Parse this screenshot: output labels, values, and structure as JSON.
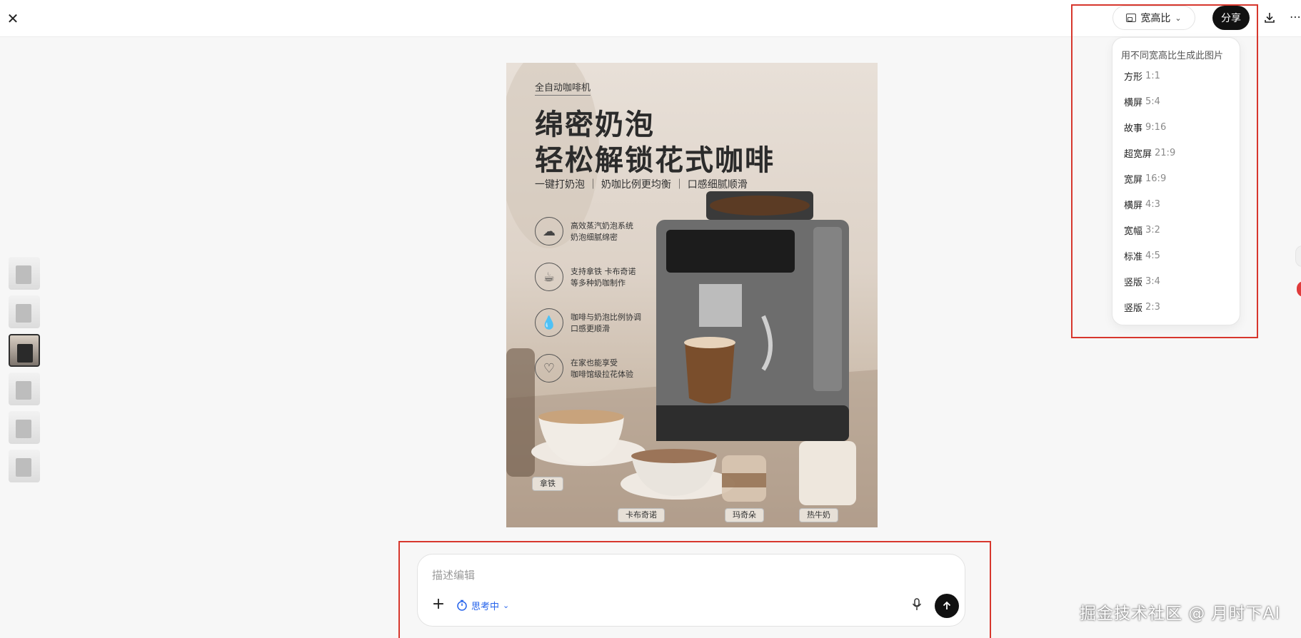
{
  "topbar": {
    "close_icon": "close-icon",
    "aspect_button_label": "宽高比",
    "share_label": "分享",
    "download_icon": "download-icon",
    "more_icon": "more-icon"
  },
  "aspect_menu": {
    "title": "用不同宽高比生成此图片",
    "options": [
      {
        "name": "方形",
        "ratio": "1:1"
      },
      {
        "name": "横屏",
        "ratio": "5:4"
      },
      {
        "name": "故事",
        "ratio": "9:16"
      },
      {
        "name": "超宽屏",
        "ratio": "21:9"
      },
      {
        "name": "宽屏",
        "ratio": "16:9"
      },
      {
        "name": "横屏",
        "ratio": "4:3"
      },
      {
        "name": "宽幅",
        "ratio": "3:2"
      },
      {
        "name": "标准",
        "ratio": "4:5"
      },
      {
        "name": "竖版",
        "ratio": "3:4"
      },
      {
        "name": "竖版",
        "ratio": "2:3"
      }
    ]
  },
  "thumbnails": {
    "count": 6,
    "active_index": 2
  },
  "poster": {
    "tag": "全自动咖啡机",
    "headline1": "绵密奶泡",
    "headline2": "轻松解锁花式咖啡",
    "subline": "一键打奶泡 ｜ 奶咖比例更均衡 ｜ 口感细腻顺滑",
    "features": [
      {
        "icon": "steam-cloud-icon",
        "line1": "高效蒸汽奶泡系统",
        "line2": "奶泡细腻绵密"
      },
      {
        "icon": "cup-icon",
        "line1": "支持拿铁 卡布奇诺",
        "line2": "等多种奶咖制作"
      },
      {
        "icon": "drop-icon",
        "line1": "咖啡与奶泡比例协调",
        "line2": "口感更顺滑"
      },
      {
        "icon": "latte-art-icon",
        "line1": "在家也能享受",
        "line2": "咖啡馆级拉花体验"
      }
    ],
    "cup_labels": [
      "拿铁",
      "卡布奇诺",
      "玛奇朵",
      "热牛奶"
    ]
  },
  "composer": {
    "placeholder": "描述编辑",
    "add_icon": "plus-icon",
    "thinking_label": "思考中",
    "mic_icon": "mic-icon",
    "send_icon": "arrow-up-icon"
  },
  "watermark": "掘金技术社区 @ 月时下AI"
}
